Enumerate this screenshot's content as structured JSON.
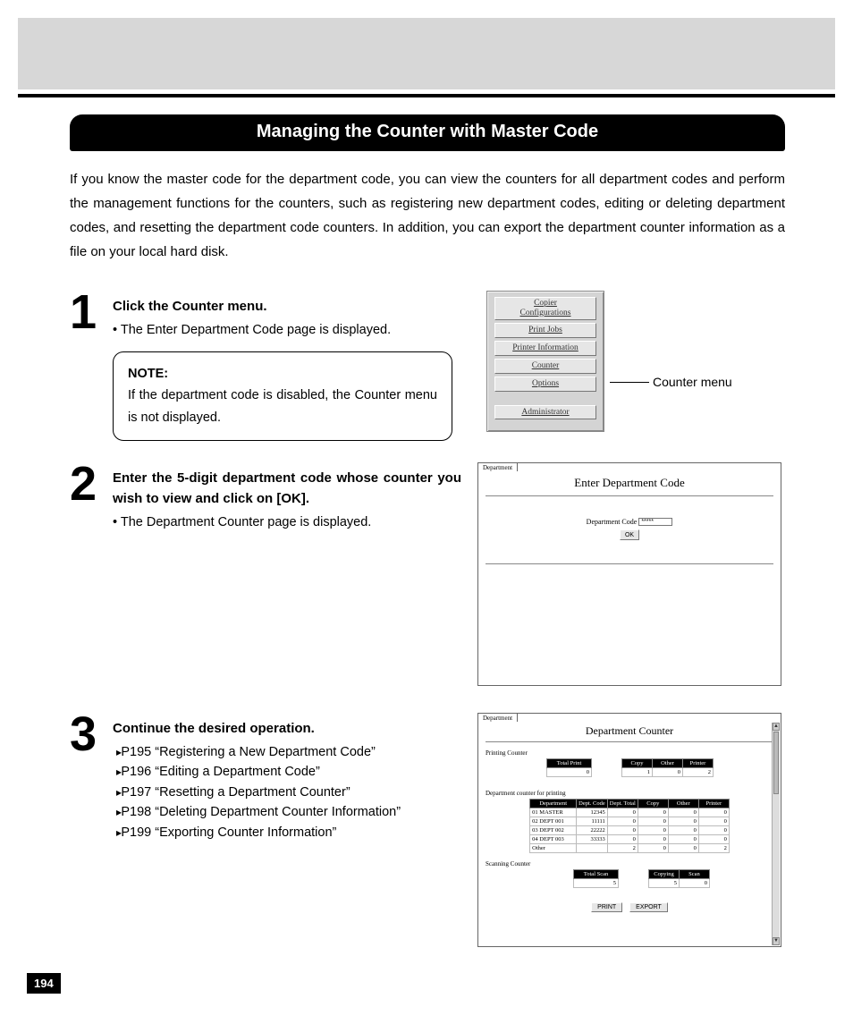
{
  "page_number": "194",
  "heading": "Managing the Counter with Master Code",
  "intro": "If you know the master code for the department code, you can view the counters for all department codes and perform the management functions for the counters, such as registering new department codes, editing or deleting department codes, and resetting the department code counters.  In addition, you can export the department counter information as a file on your local hard disk.",
  "steps": {
    "s1": {
      "num": "1",
      "title": "Click the Counter menu.",
      "bullet": "The Enter Department Code page is displayed.",
      "note_label": "NOTE:",
      "note_text": "If the department code is disabled, the Counter menu is not displayed."
    },
    "s2": {
      "num": "2",
      "title": "Enter the 5-digit department code whose counter you wish to view and click on [OK].",
      "bullet": "The Department Counter page is displayed."
    },
    "s3": {
      "num": "3",
      "title": "Continue the desired operation.",
      "refs": [
        "P195 “Registering a New Department Code”",
        "P196 “Editing a Department Code”",
        "P197 “Resetting a Department Counter”",
        "P198 “Deleting Department Counter Information”",
        "P199 “Exporting Counter Information”"
      ]
    }
  },
  "menu_shot": {
    "items": [
      "Copier\nConfigurations",
      "Print Jobs",
      "Printer Information",
      "Counter",
      "Options",
      "",
      "Administrator"
    ],
    "callout": "Counter menu"
  },
  "enter_shot": {
    "tab": "Department",
    "title": "Enter Department Code",
    "field_label": "Department Code",
    "field_value": "*****",
    "ok": "OK"
  },
  "counter_shot": {
    "tab": "Department",
    "title": "Department Counter",
    "printing_label": "Printing Counter",
    "printing_headers": [
      "Total Print",
      "Copy",
      "Other",
      "Printer"
    ],
    "printing_values": [
      "0",
      "1",
      "0",
      "2"
    ],
    "dept_label": "Department counter for printing",
    "dept_headers": [
      "Department",
      "Dept. Code",
      "Dept. Total",
      "Copy",
      "Other",
      "Printer"
    ],
    "dept_rows": [
      [
        "01 MASTER",
        "12345",
        "0",
        "0",
        "0",
        "0"
      ],
      [
        "02 DEPT 001",
        "11111",
        "0",
        "0",
        "0",
        "0"
      ],
      [
        "03 DEPT 002",
        "22222",
        "0",
        "0",
        "0",
        "0"
      ],
      [
        "04 DEPT 003",
        "33333",
        "0",
        "0",
        "0",
        "0"
      ],
      [
        "Other",
        "",
        "2",
        "0",
        "0",
        "2"
      ]
    ],
    "scan_label": "Scanning Counter",
    "scan_headers": [
      "Total Scan",
      "Copying",
      "Scan"
    ],
    "scan_values": [
      "5",
      "5",
      "0"
    ],
    "buttons": [
      "PRINT",
      "EXPORT"
    ]
  }
}
